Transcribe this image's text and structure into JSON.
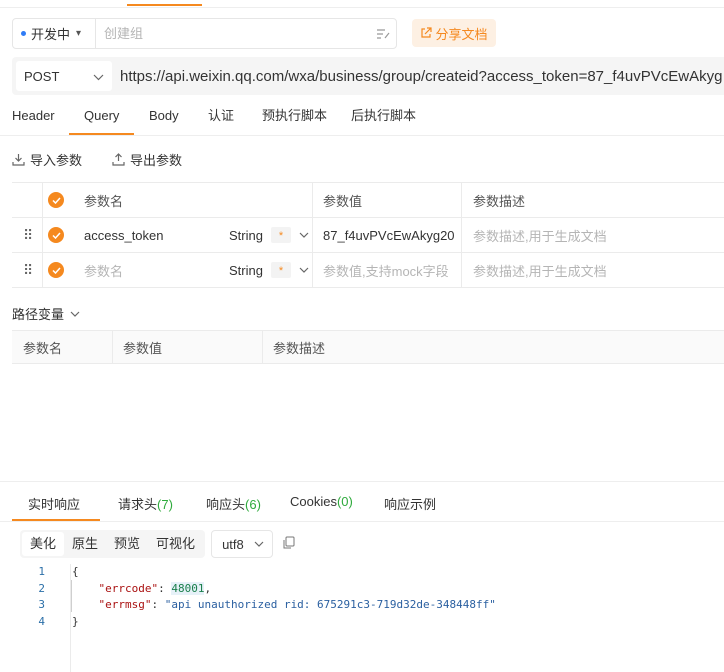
{
  "env": {
    "selected": "开发中",
    "group_placeholder": "创建组"
  },
  "share_label": "分享文档",
  "request": {
    "method": "POST",
    "url": "https://api.weixin.qq.com/wxa/business/group/createid?access_token=87_f4uvPVcEwAkyg"
  },
  "tabs": [
    {
      "label": "Header"
    },
    {
      "label": "Query"
    },
    {
      "label": "Body"
    },
    {
      "label": "认证"
    },
    {
      "label": "预执行脚本"
    },
    {
      "label": "后执行脚本"
    }
  ],
  "active_tab": "Query",
  "io": {
    "import_label": "导入参数",
    "export_label": "导出参数"
  },
  "params": {
    "headers": [
      "参数名",
      "参数值",
      "参数描述"
    ],
    "rows": [
      {
        "name": "access_token",
        "type": "String",
        "required": "*",
        "value": "87_f4uvPVcEwAkyg20",
        "desc": "参数描述,用于生成文档"
      },
      {
        "name": "参数名",
        "type": "String",
        "required": "*",
        "value": "参数值,支持mock字段",
        "desc": "参数描述,用于生成文档"
      }
    ]
  },
  "path_vars": {
    "title": "路径变量",
    "headers": [
      "参数名",
      "参数值",
      "参数描述"
    ]
  },
  "response": {
    "tabs": [
      {
        "label": "实时响应",
        "count": ""
      },
      {
        "label": "请求头",
        "count": "(7)"
      },
      {
        "label": "响应头",
        "count": "(6)"
      },
      {
        "label": "Cookies",
        "count": "(0)"
      },
      {
        "label": "响应示例",
        "count": ""
      }
    ],
    "formats": [
      "美化",
      "原生",
      "预览",
      "可视化"
    ],
    "active_format": "美化",
    "encoding": "utf8",
    "lines": [
      {
        "num": "1",
        "text": "{"
      },
      {
        "num": "2",
        "key": "\"errcode\"",
        "val": "48001",
        "tail": ","
      },
      {
        "num": "3",
        "key": "\"errmsg\"",
        "str": "\"api unauthorized rid: 675291c3-719d32de-348448ff\""
      },
      {
        "num": "4",
        "text": "}"
      }
    ]
  },
  "colors": {
    "accent": "#f5891f",
    "env_dot": "#2f7cf6",
    "count_green": "#2eaa3c"
  }
}
